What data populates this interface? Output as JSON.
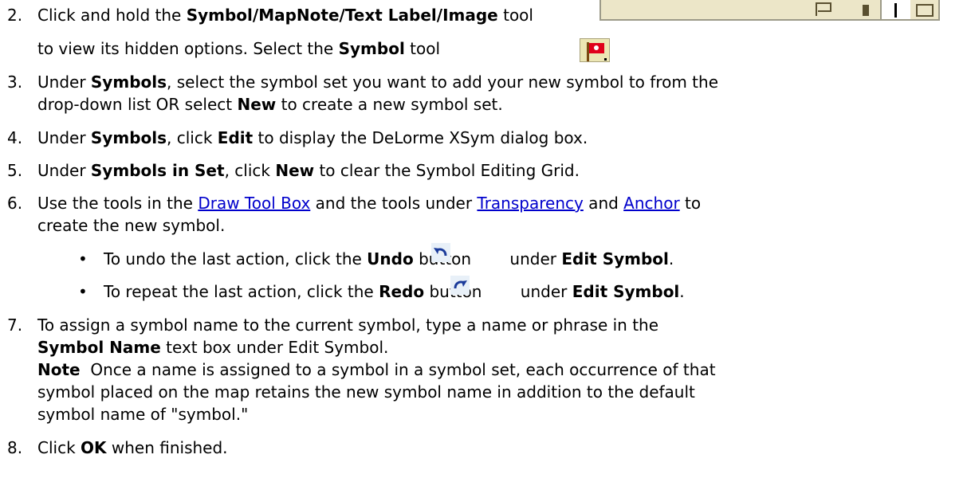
{
  "steps": [
    {
      "num": "2.",
      "pre": "Click and hold the ",
      "bold": "Symbol/MapNote/Text Label/Image",
      "post": " tool"
    },
    {
      "cont": "to view its hidden options. Select the ",
      "bold": "Symbol",
      "post": " tool"
    },
    {
      "num": "3.",
      "l1_pre": "Under ",
      "l1_bold": "Symbols",
      "l1_post": ", select the symbol set you want to add your new symbol to from the",
      "l2_pre": "drop-down list OR select ",
      "l2_bold": "New",
      "l2_post": " to create a new symbol set."
    },
    {
      "num": "4.",
      "pre": "Under ",
      "bold1": "Symbols",
      "mid": ", click ",
      "bold2": "Edit",
      "post": " to display the DeLorme XSym dialog box."
    },
    {
      "num": "5.",
      "pre": "Under ",
      "bold1": "Symbols in Set",
      "mid": ", click ",
      "bold2": "New",
      "post": " to clear the Symbol Editing Grid."
    },
    {
      "num": "6.",
      "pre": "Use the tools in the ",
      "link1": "Draw Tool Box",
      "mid": " and the tools under ",
      "link2": "Transparency",
      "and": " and ",
      "link3": "Anchor",
      "post": " to",
      "l2": "create the new symbol."
    },
    {
      "num": "7.",
      "l1": "To assign a symbol name to the current symbol, type a name or phrase in the",
      "l2_bold": "Symbol Name",
      "l2_post": " text box under Edit Symbol.",
      "note_bold": "Note",
      "note1": "  Once a name is assigned to a symbol in a symbol set, each occurrence of that",
      "note2": "symbol placed on the map retains the new symbol name in addition to the default",
      "note3": "symbol name of \"symbol.\""
    },
    {
      "num": "8.",
      "pre": "Click ",
      "bold": "OK",
      "post": " when finished."
    }
  ],
  "bullets": [
    {
      "mark": "•",
      "pre": "To undo the last action, click the ",
      "bold1": "Undo",
      "mid": " button",
      "post": " under ",
      "bold2": "Edit Symbol",
      "end": "."
    },
    {
      "mark": "•",
      "pre": "To repeat the last action, click the ",
      "bold1": "Redo",
      "mid": " button",
      "post": " under ",
      "bold2": "Edit Symbol",
      "end": "."
    }
  ],
  "icons": {
    "toolbar": "symbol-mapnote-textlabel-image-toolbar",
    "symbol": "red-flag-symbol",
    "undo": "undo-arrow",
    "redo": "redo-arrow"
  },
  "colors": {
    "link": "#0000cc",
    "toolbar_bg": "#ece6c8",
    "flag": "#e0001a"
  }
}
